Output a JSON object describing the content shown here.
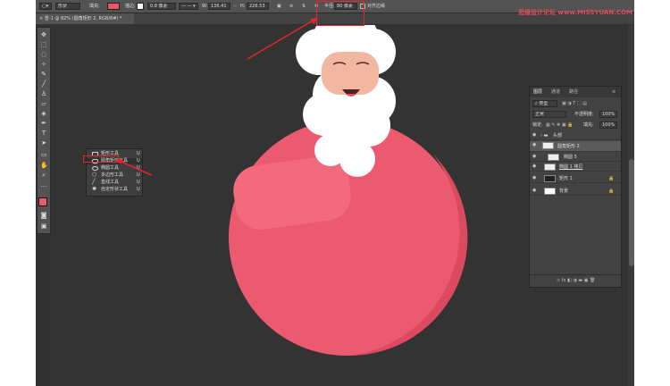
{
  "watermark": "思缘设计论坛 www.MISSYUAN.COM",
  "options_bar": {
    "mode": "形状",
    "fill_label": "填充:",
    "fill_color": "#e85669",
    "stroke_label": "描边:",
    "stroke_width": "0.8 像素",
    "w_label": "W:",
    "w_value": "136.41",
    "h_label": "H:",
    "h_value": "226.53",
    "radius_label": "半径:",
    "radius_value": "80 像素",
    "align_edges": "对齐边缘"
  },
  "doc_tab": "×  雪-1 @ 82% (圆角矩形 2, RGB/8#) *",
  "tool_flyout": {
    "items": [
      {
        "label": "矩形工具",
        "key": "U"
      },
      {
        "label": "圆角矩形工具",
        "key": "U"
      },
      {
        "label": "椭圆工具",
        "key": "U"
      },
      {
        "label": "多边形工具",
        "key": "U"
      },
      {
        "label": "直线工具",
        "key": "U"
      },
      {
        "label": "自定形状工具",
        "key": "U"
      }
    ]
  },
  "layers_panel": {
    "tabs": [
      "图层",
      "通道",
      "路径"
    ],
    "kind_filter": "类型",
    "blend_mode": "正常",
    "opacity_label": "不透明度:",
    "opacity_value": "100%",
    "lock_label": "锁定:",
    "fill_label": "填充:",
    "fill_value": "100%",
    "layers": [
      {
        "name": "头部"
      },
      {
        "name": "圆角矩形 2"
      },
      {
        "name": "椭圆 5"
      },
      {
        "name": "椭圆 1 拷贝"
      },
      {
        "name": "矩形 1"
      },
      {
        "name": "背景"
      }
    ]
  },
  "colors": {
    "body": "#ec5a6f",
    "body_shade": "#dc4a60",
    "arm": "#f36a7d",
    "beard": "#ffffff",
    "face": "#f2b7a1",
    "annotation": "#e4262b"
  }
}
